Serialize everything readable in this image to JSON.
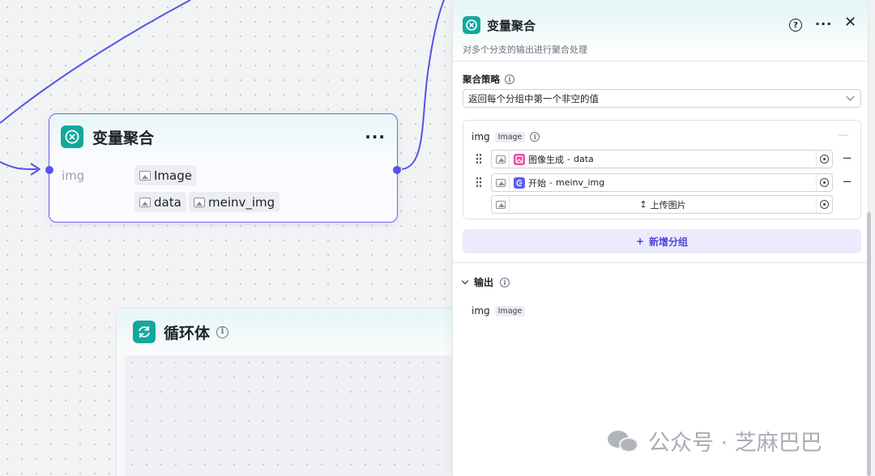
{
  "canvas": {
    "aggregate_node": {
      "title": "变量聚合",
      "more": "···",
      "var_label": "img",
      "chips": [
        "Image",
        "data",
        "meinv_img"
      ]
    },
    "loop_node": {
      "title": "循环体",
      "info": "i"
    }
  },
  "panel": {
    "title": "变量聚合",
    "description": "对多个分支的输出进行聚合处理",
    "help": "?",
    "more": "···",
    "close": "✕",
    "strategy": {
      "label": "聚合策略",
      "info": "i",
      "value": "返回每个分组中第一个非空的值"
    },
    "group": {
      "name": "img",
      "type": "Image",
      "info": "i",
      "dash": "—",
      "items": [
        {
          "source": "图像生成",
          "sep": " - ",
          "var": "data",
          "remove": "−"
        },
        {
          "source": "开始",
          "sep": " - ",
          "var": "meinv_img",
          "remove": "−"
        }
      ],
      "upload": "上传图片",
      "upload_icon": "↥"
    },
    "add_group": {
      "icon": "+",
      "label": "新增分组"
    },
    "output": {
      "label": "输出",
      "info": "i",
      "var": "img",
      "type": "Image"
    }
  },
  "watermark": {
    "text": "公众号 · 芝麻巴巴"
  },
  "colors": {
    "accent": "#5a52e8",
    "teal": "#13a89e",
    "image_gen_icon": "#e84ba6",
    "start_icon": "#5b5ef0"
  }
}
